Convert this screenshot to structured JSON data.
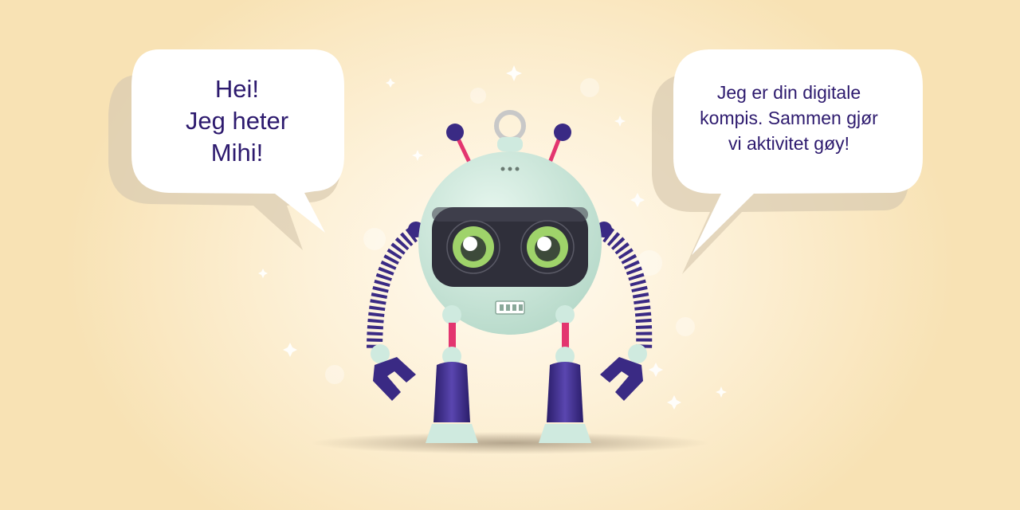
{
  "bubbles": {
    "left": {
      "lines": [
        "Hei!",
        "Jeg heter",
        "Mihi!"
      ]
    },
    "right": {
      "lines": [
        "Jeg er din digitale",
        "kompis. Sammen gjør",
        "vi aktivitet gøy!"
      ]
    }
  },
  "colors": {
    "background": "#fdf1d8",
    "text": "#2d1a6e",
    "robot_body": "#cfeadf",
    "robot_purple": "#3a2a84",
    "robot_pink": "#e3356f",
    "eye_green": "#9fd36a",
    "visor": "#2f2f3a"
  },
  "icons": [
    "robot-mascot",
    "speech-bubble-left",
    "speech-bubble-right",
    "sparkle-stars"
  ]
}
